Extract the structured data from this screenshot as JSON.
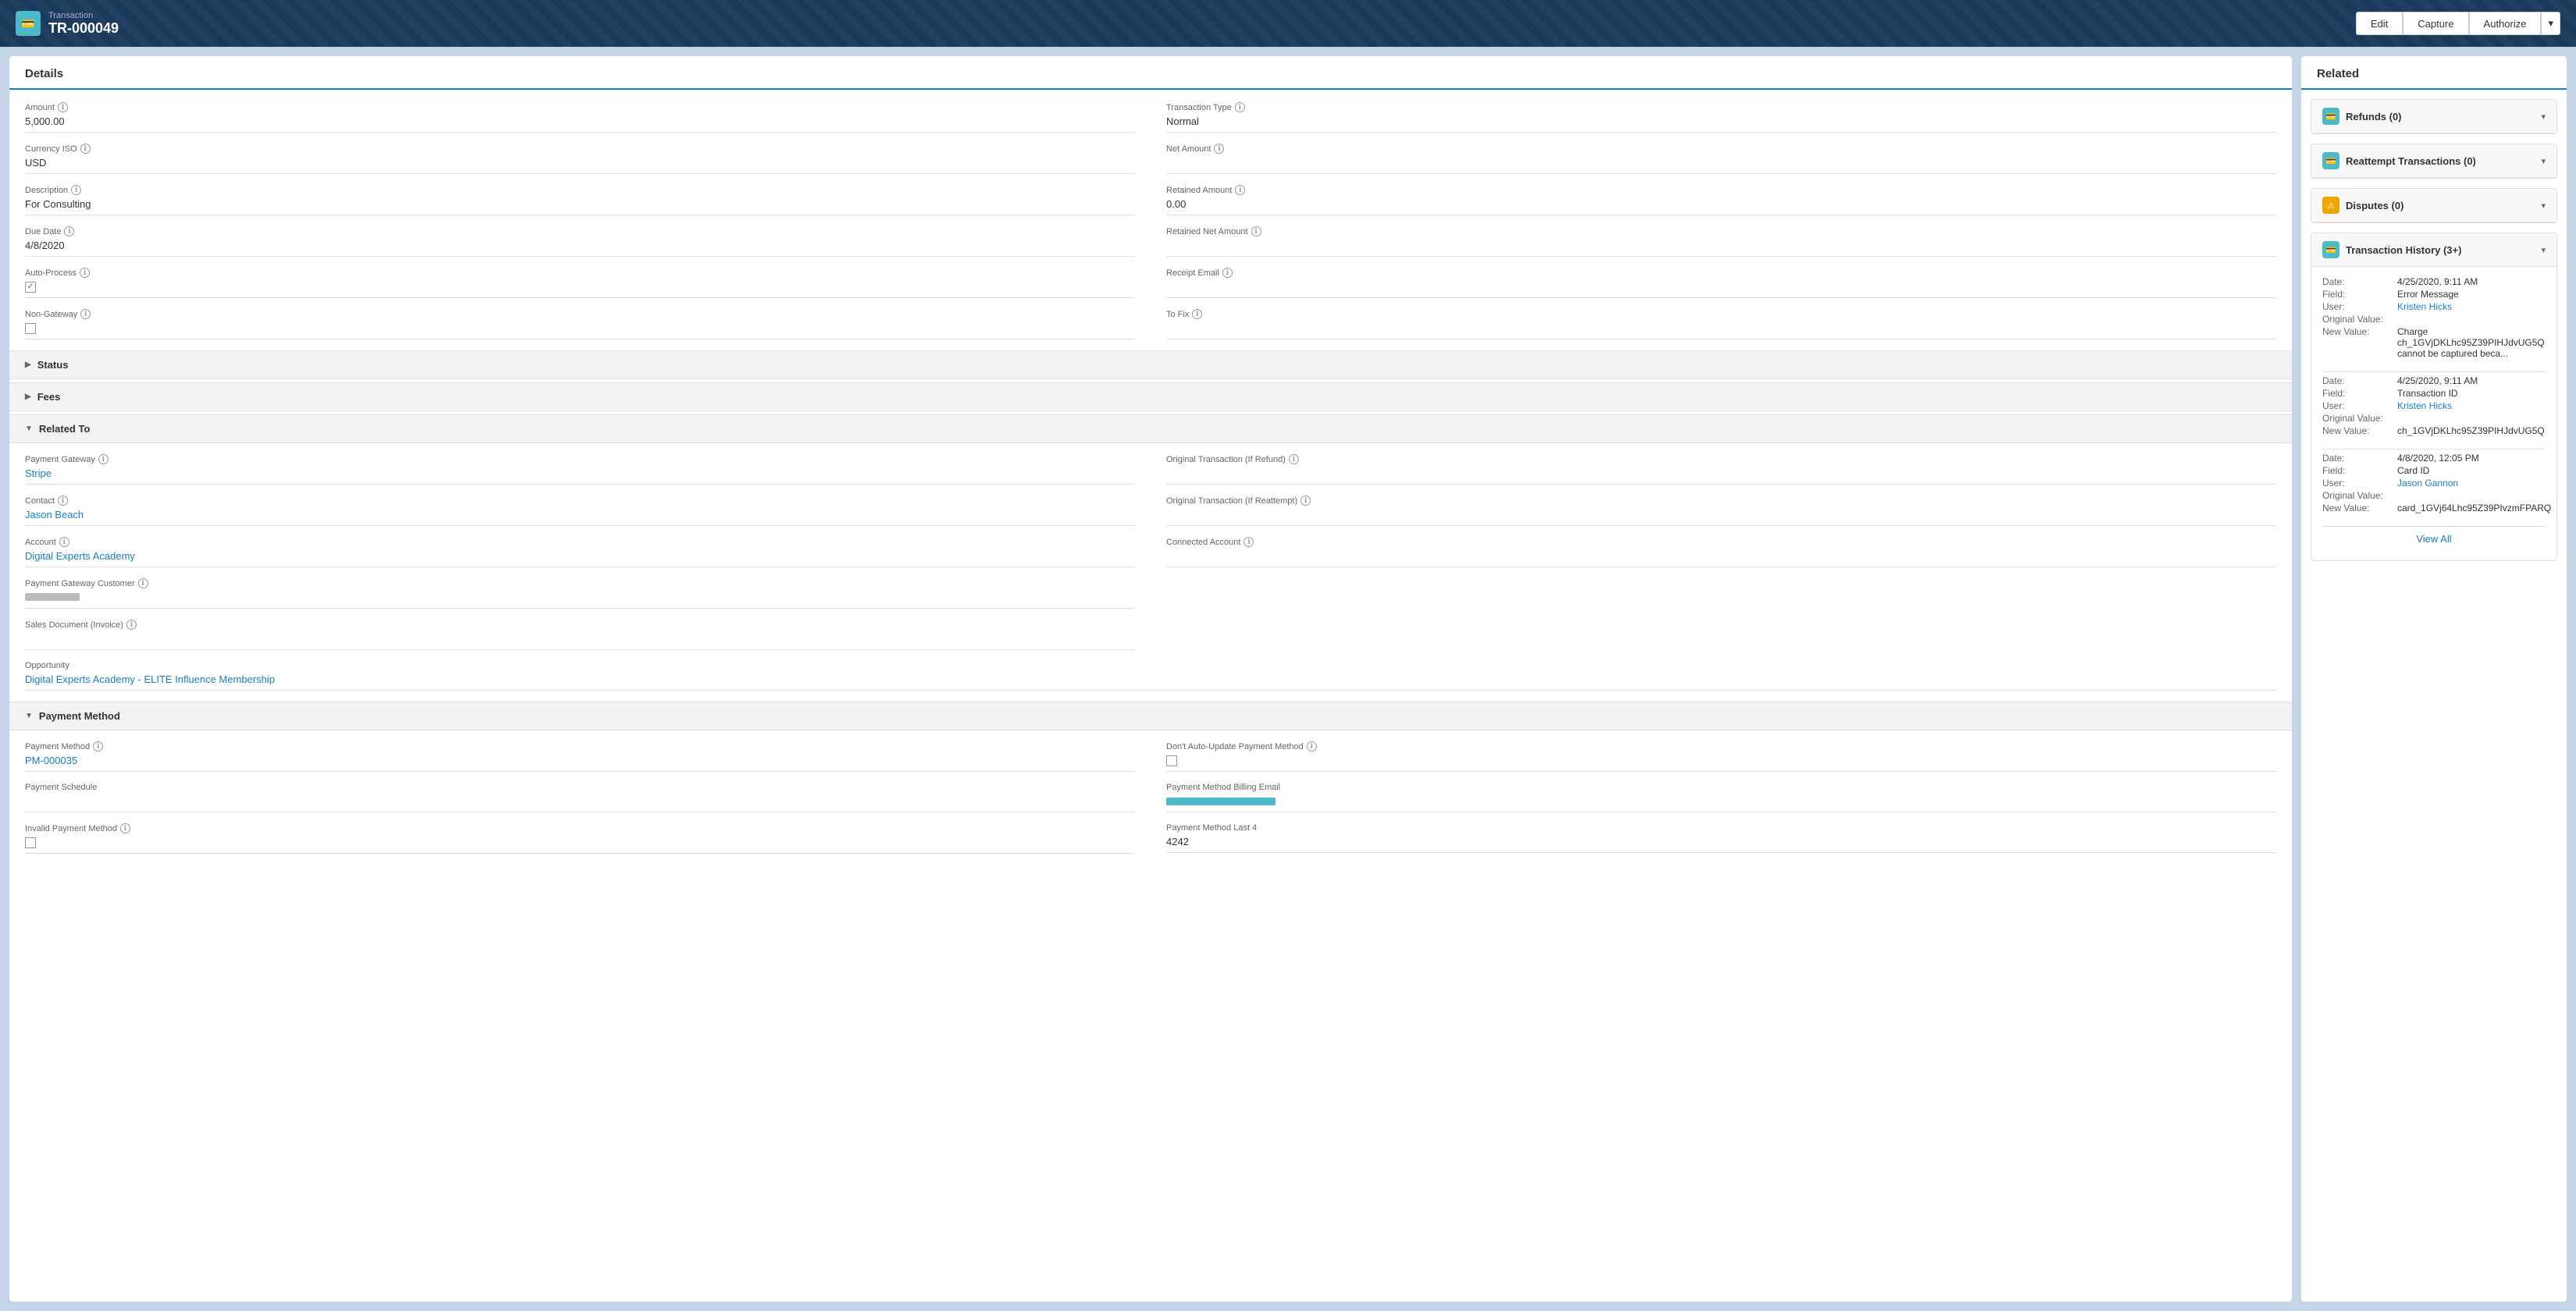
{
  "header": {
    "icon": "💳",
    "subtitle": "Transaction",
    "title": "TR-000049",
    "buttons": {
      "edit": "Edit",
      "capture": "Capture",
      "authorize": "Authorize"
    }
  },
  "details_panel": {
    "heading": "Details",
    "fields": {
      "amount_label": "Amount",
      "amount_value": "5,000.00",
      "currency_iso_label": "Currency ISO",
      "currency_iso_value": "USD",
      "description_label": "Description",
      "description_value": "For Consulting",
      "due_date_label": "Due Date",
      "due_date_value": "4/8/2020",
      "auto_process_label": "Auto-Process",
      "non_gateway_label": "Non-Gateway",
      "transaction_type_label": "Transaction Type",
      "transaction_type_value": "Normal",
      "net_amount_label": "Net Amount",
      "retained_amount_label": "Retained Amount",
      "retained_amount_value": "0.00",
      "retained_net_amount_label": "Retained Net Amount",
      "receipt_email_label": "Receipt Email",
      "to_fix_label": "To Fix"
    }
  },
  "sections": {
    "status": "Status",
    "fees": "Fees",
    "related_to": "Related To",
    "payment_method": "Payment Method"
  },
  "related_to": {
    "payment_gateway_label": "Payment Gateway",
    "payment_gateway_value": "Stripe",
    "contact_label": "Contact",
    "contact_value": "Jason Beach",
    "account_label": "Account",
    "account_value": "Digital Experts Academy",
    "payment_gateway_customer_label": "Payment Gateway Customer",
    "sales_document_label": "Sales Document (Invoice)",
    "opportunity_label": "Opportunity",
    "opportunity_value": "Digital Experts Academy - ELITE Influence Membership",
    "original_transaction_refund_label": "Original Transaction (If Refund)",
    "original_transaction_reattempt_label": "Original Transaction (If Reattempt)",
    "connected_account_label": "Connected Account"
  },
  "payment_method": {
    "payment_method_label": "Payment Method",
    "payment_method_value": "PM-000035",
    "payment_schedule_label": "Payment Schedule",
    "invalid_payment_label": "Invalid Payment Method",
    "dont_auto_update_label": "Don't Auto-Update Payment Method",
    "billing_email_label": "Payment Method Billing Email",
    "last4_label": "Payment Method Last 4",
    "last4_value": "4242"
  },
  "related_panel": {
    "heading": "Related",
    "refunds": "Refunds (0)",
    "reattempt": "Reattempt Transactions (0)",
    "disputes": "Disputes (0)",
    "transaction_history": "Transaction History (3+)",
    "history_entries": [
      {
        "date_label": "Date:",
        "date_value": "4/25/2020, 9:11 AM",
        "field_label": "Field:",
        "field_value": "Error Message",
        "user_label": "User:",
        "user_value": "Kristen Hicks",
        "original_value_label": "Original Value:",
        "original_value_value": "",
        "new_value_label": "New Value:",
        "new_value_value": "Charge ch_1GVjDKLhc95Z39PIHJdvUG5Q cannot be captured beca..."
      },
      {
        "date_label": "Date:",
        "date_value": "4/25/2020, 9:11 AM",
        "field_label": "Field:",
        "field_value": "Transaction ID",
        "user_label": "User:",
        "user_value": "Kristen Hicks",
        "original_value_label": "Original Value:",
        "original_value_value": "",
        "new_value_label": "New Value:",
        "new_value_value": "ch_1GVjDKLhc95Z39PIHJdvUG5Q"
      },
      {
        "date_label": "Date:",
        "date_value": "4/8/2020, 12:05 PM",
        "field_label": "Field:",
        "field_value": "Card ID",
        "user_label": "User:",
        "user_value": "Jason Gannon",
        "original_value_label": "Original Value:",
        "original_value_value": "",
        "new_value_label": "New Value:",
        "new_value_value": "card_1GVj64Lhc95Z39PIvzmFPARQ"
      }
    ],
    "view_all": "View All"
  }
}
